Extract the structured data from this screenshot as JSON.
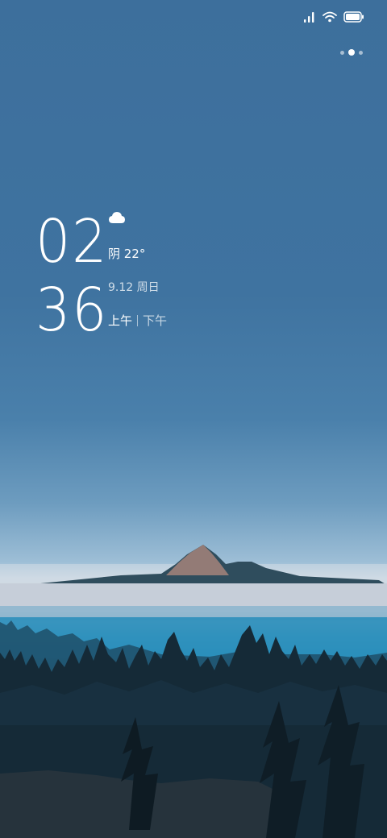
{
  "status_bar": {
    "signal_icon": "signal-icon",
    "wifi_icon": "wifi-icon",
    "battery_icon": "battery-icon",
    "battery_level": 1.0
  },
  "pager": {
    "pages": 3,
    "active_index": 1
  },
  "clock": {
    "hours": "02",
    "minutes": "36"
  },
  "weather": {
    "icon": "cloud-icon",
    "text": "阴 22°"
  },
  "date": {
    "text": "9.12 周日"
  },
  "ampm": {
    "am": "上午",
    "pm": "下午",
    "selected": "am"
  },
  "colors": {
    "sky": "#3f73a0",
    "fog": "#c8d7e3",
    "lake": "#2c8db8",
    "forest": "#18384b"
  }
}
